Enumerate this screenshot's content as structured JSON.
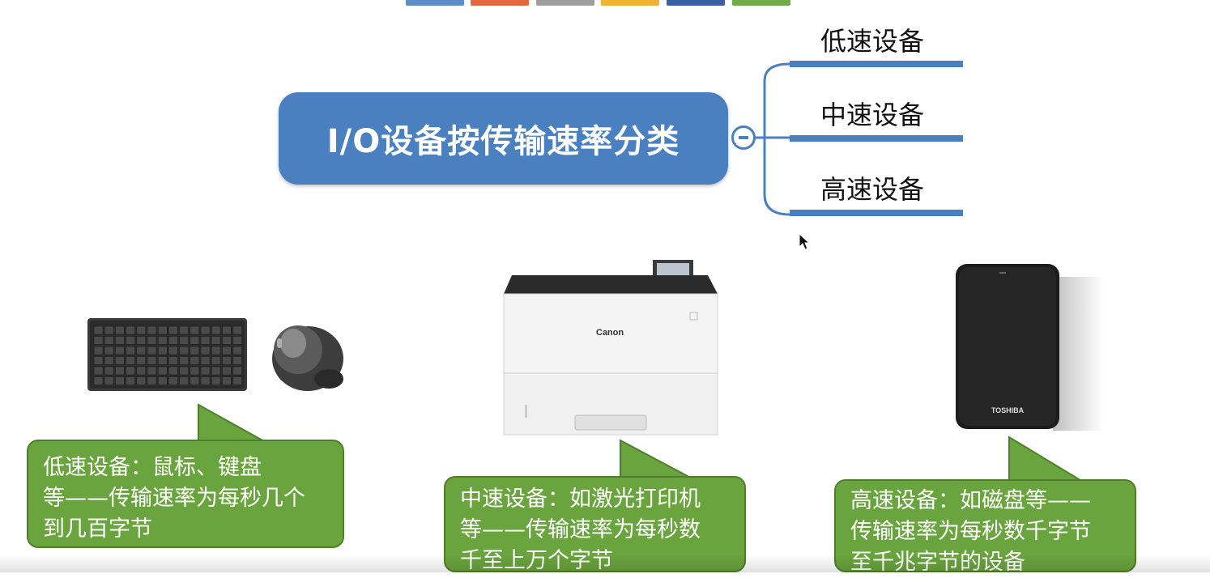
{
  "mindmap": {
    "root_label": "I/O设备按传输速率分类",
    "branches": [
      {
        "label": "低速设备"
      },
      {
        "label": "中速设备"
      },
      {
        "label": "高速设备"
      }
    ]
  },
  "devices": {
    "printer_brand": "Canon",
    "drive_brand": "TOSHIBA"
  },
  "callouts": {
    "low": {
      "lines": [
        "低速设备：鼠标、键盘",
        "等——传输速率为每秒几个",
        "到几百字节"
      ]
    },
    "mid": {
      "lines": [
        "中速设备：如激光打印机",
        "等——传输速率为每秒数",
        "千至上万个字节"
      ]
    },
    "high": {
      "lines": [
        "高速设备：如磁盘等——",
        "传输速率为每秒数千字节",
        "至千兆字节的设备"
      ]
    }
  },
  "colors": {
    "accent_blue": "#4a7fc0",
    "callout_green": "#6aa43e",
    "tabs": [
      "#5b8fc9",
      "#e06a3c",
      "#9e9e9e",
      "#f2b233",
      "#3a5fa8",
      "#70ad47"
    ]
  }
}
